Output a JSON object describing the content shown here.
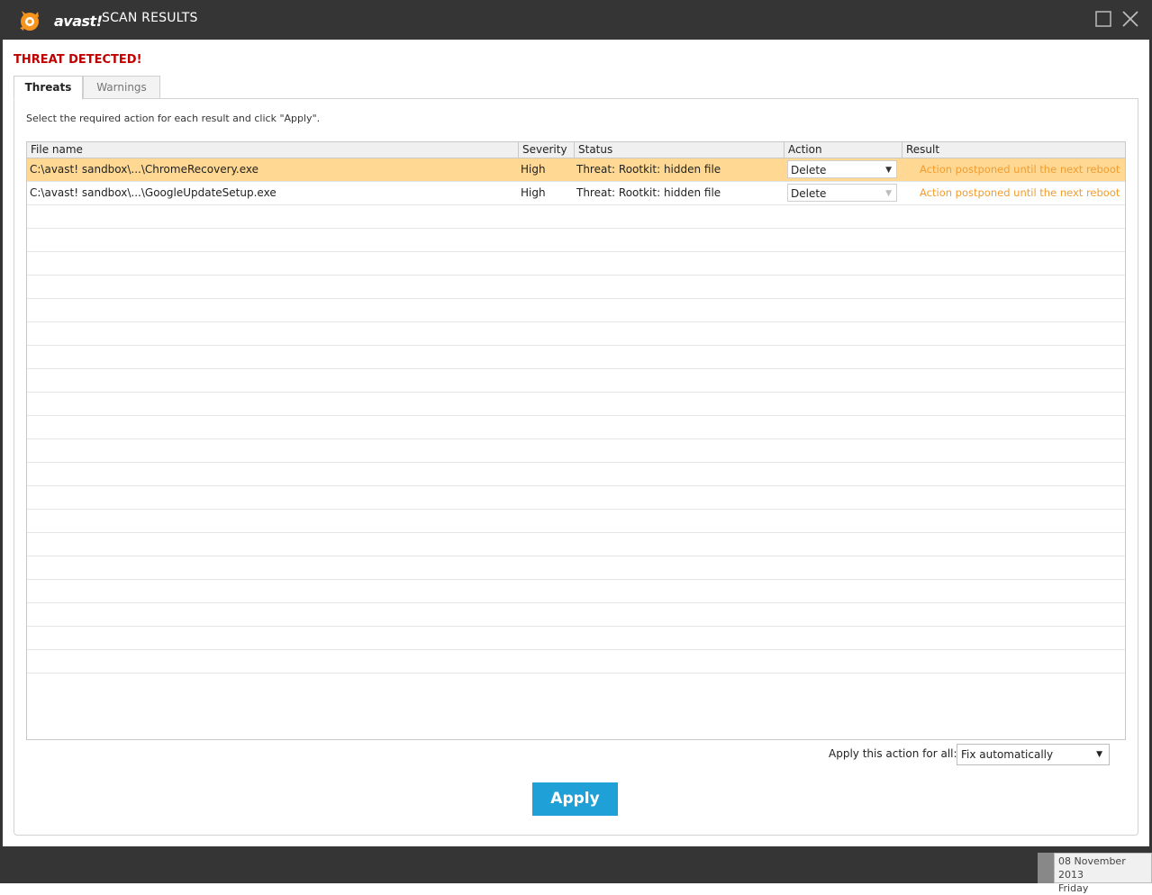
{
  "window": {
    "logo_text": "avast!",
    "title": "SCAN RESULTS"
  },
  "alert": "THREAT DETECTED!",
  "tabs": [
    {
      "label": "Threats",
      "active": true
    },
    {
      "label": "Warnings",
      "active": false
    }
  ],
  "instruction": "Select the required action for each result and click \"Apply\".",
  "table": {
    "columns": [
      "File name",
      "Severity",
      "Status",
      "Action",
      "Result"
    ],
    "rows": [
      {
        "file": "C:\\avast! sandbox\\...\\ChromeRecovery.exe",
        "severity": "High",
        "status": "Threat: Rootkit: hidden file",
        "action": "Delete",
        "result": "Action postponed until the next reboot",
        "selected": true
      },
      {
        "file": "C:\\avast! sandbox\\...\\GoogleUpdateSetup.exe",
        "severity": "High",
        "status": "Threat: Rootkit: hidden file",
        "action": "Delete",
        "result": "Action postponed until the next reboot",
        "selected": false
      }
    ]
  },
  "apply_all": {
    "label": "Apply this action for all:",
    "value": "Fix automatically"
  },
  "apply_button": "Apply",
  "clock": {
    "date": "08 November 2013",
    "day": "Friday"
  },
  "colors": {
    "titlebar": "#353535",
    "alert": "#c00000",
    "selected_row": "#ffd993",
    "result_text": "#f39c2f",
    "apply_button": "#1fa0d6",
    "logo_orange": "#f7941d"
  },
  "icons": [
    "avast-logo-icon",
    "maximize-icon",
    "close-icon",
    "chevron-down-icon"
  ]
}
